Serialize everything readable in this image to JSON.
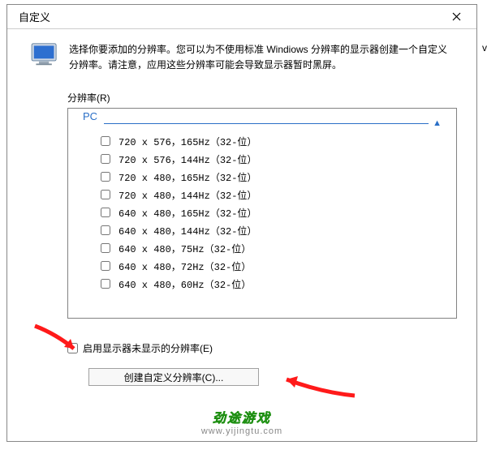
{
  "dialog": {
    "title": "自定义",
    "description": "选择你要添加的分辨率。您可以为不使用标准 Windiows 分辨率的显示器创建一个自定义分辨率。请注意，应用这些分辨率可能会导致显示器暂时黑屏。",
    "resolution_label": "分辨率(R)",
    "group": "PC",
    "items": [
      {
        "label": "720 x 576，165Hz（32-位）"
      },
      {
        "label": "720 x 576，144Hz（32-位）"
      },
      {
        "label": "720 x 480，165Hz（32-位）"
      },
      {
        "label": "720 x 480，144Hz（32-位）"
      },
      {
        "label": "640 x 480，165Hz（32-位）"
      },
      {
        "label": "640 x 480，144Hz（32-位）"
      },
      {
        "label": "640 x 480，75Hz（32-位）"
      },
      {
        "label": "640 x 480，72Hz（32-位）"
      },
      {
        "label": "640 x 480，60Hz（32-位）"
      }
    ],
    "enable_hidden_label": "启用显示器未显示的分辨率(E)",
    "create_custom_label": "创建自定义分辨率(C)..."
  },
  "watermark": {
    "brand": "劲途游戏",
    "url": "www.yijingtu.com"
  },
  "tail_char": "v"
}
